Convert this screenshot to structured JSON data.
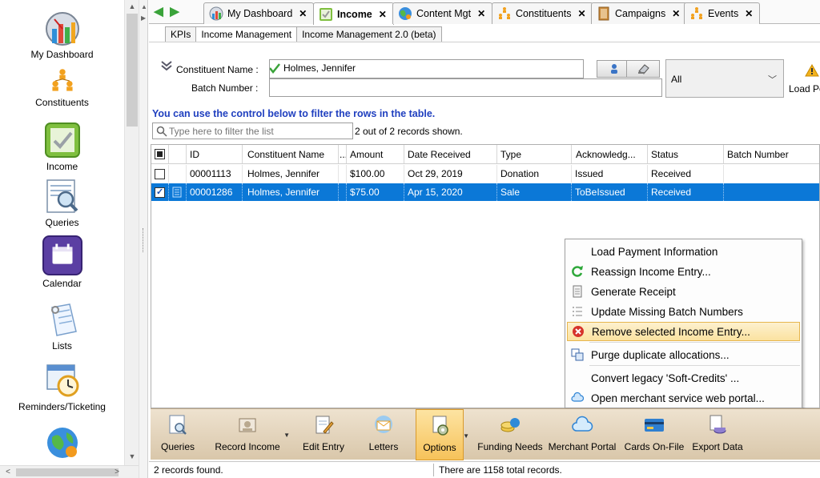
{
  "sidebar": {
    "items": [
      {
        "label": "My Dashboard",
        "icon": "dashboard-icon"
      },
      {
        "label": "Constituents",
        "icon": "constituents-icon"
      },
      {
        "label": "Income",
        "icon": "income-icon"
      },
      {
        "label": "Queries",
        "icon": "queries-icon"
      },
      {
        "label": "Calendar",
        "icon": "calendar-icon"
      },
      {
        "label": "Lists",
        "icon": "lists-icon"
      },
      {
        "label": "Reminders/Ticketing",
        "icon": "reminders-icon"
      }
    ]
  },
  "tabs": [
    {
      "label": "My Dashboard",
      "icon": "dashboard-icon",
      "active": false
    },
    {
      "label": "Income",
      "icon": "income-icon",
      "active": true
    },
    {
      "label": "Content Mgt",
      "icon": "globe-icon",
      "active": false
    },
    {
      "label": "Constituents",
      "icon": "constituents-icon",
      "active": false
    },
    {
      "label": "Campaigns",
      "icon": "campaigns-icon",
      "active": false
    },
    {
      "label": "Events",
      "icon": "events-icon",
      "active": false
    }
  ],
  "subtabs": [
    {
      "label": "KPIs",
      "active": false
    },
    {
      "label": "Income Management",
      "active": true
    },
    {
      "label": "Income Management 2.0 (beta)",
      "active": false
    }
  ],
  "filter": {
    "constituent_label": "Constituent Name :",
    "constituent_value": "Holmes, Jennifer",
    "batch_label": "Batch Number :",
    "batch_value": "",
    "dropdown_value": "All",
    "load_label": "Load Pe"
  },
  "hint": "You can use the control below to filter the rows in the table.",
  "search": {
    "placeholder": "Type here to filter the list"
  },
  "record_count": "2 out of 2 records shown.",
  "grid": {
    "columns": [
      "ID",
      "Constituent Name",
      "...",
      "Amount",
      "Date Received",
      "Type",
      "Acknowledg...",
      "Status",
      "Batch Number"
    ],
    "rows": [
      {
        "id": "00001113",
        "name": "Holmes, Jennifer",
        "amount": "$100.00",
        "date": "Oct 29, 2019",
        "type": "Donation",
        "ack": "Issued",
        "status": "Received",
        "batch": "",
        "selected": false
      },
      {
        "id": "00001286",
        "name": "Holmes, Jennifer",
        "amount": "$75.00",
        "date": "Apr 15, 2020",
        "type": "Sale",
        "ack": "ToBeIssued",
        "status": "Received",
        "batch": "",
        "selected": true
      }
    ]
  },
  "context_menu": {
    "items": [
      {
        "label": "Load Payment Information",
        "icon": ""
      },
      {
        "label": "Reassign Income Entry...",
        "icon": "refresh-icon"
      },
      {
        "label": "Generate Receipt",
        "icon": "receipt-icon"
      },
      {
        "label": "Update Missing Batch Numbers",
        "icon": "list-number-icon"
      },
      {
        "label": "Remove selected Income Entry...",
        "icon": "remove-icon",
        "highlight": true
      },
      {
        "label": "Purge duplicate allocations...",
        "icon": "copy-icon"
      },
      {
        "label": "Convert legacy 'Soft-Credits' ...",
        "icon": ""
      },
      {
        "label": "Open merchant service web portal...",
        "icon": "cloud-icon"
      }
    ]
  },
  "toolbar": {
    "buttons": [
      {
        "label": "Queries",
        "icon": "queries-icon"
      },
      {
        "label": "Record Income",
        "icon": "record-income-icon"
      },
      {
        "label": "Edit Entry",
        "icon": "edit-icon"
      },
      {
        "label": "Letters",
        "icon": "letters-icon"
      },
      {
        "label": "Options",
        "icon": "options-icon",
        "active": true
      },
      {
        "label": "Funding Needs",
        "icon": "funding-icon"
      },
      {
        "label": "Merchant Portal",
        "icon": "cloud-icon"
      },
      {
        "label": "Cards On-File",
        "icon": "card-icon"
      },
      {
        "label": "Export Data",
        "icon": "export-icon"
      }
    ]
  },
  "status": {
    "left": "2 records found.",
    "right": "There are 1158 total records."
  },
  "colors": {
    "selection": "#0b78d7",
    "hint_text": "#1f3fbf",
    "menu_highlight": "#fbe2a0",
    "toolbar_bg": "#e5d4b9"
  }
}
